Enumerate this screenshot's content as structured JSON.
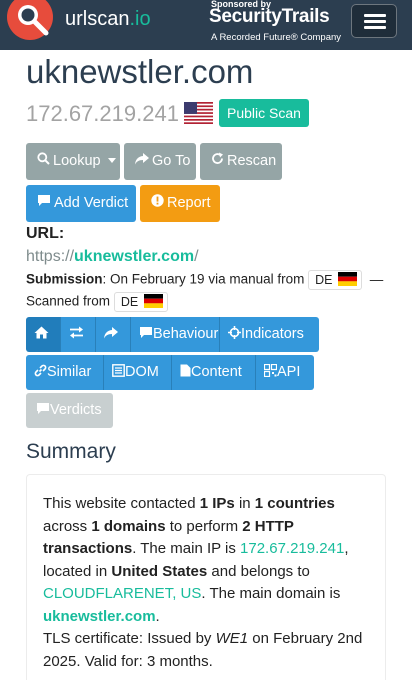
{
  "nav": {
    "brand_name": "urlscan",
    "brand_suffix": ".io",
    "sponsor_by": "Sponsored by",
    "sponsor_name": "SecurityTrails",
    "sponsor_sub": "A Recorded Future® Company"
  },
  "result": {
    "domain": "uknewstler.com",
    "ip": "172.67.219.241",
    "visibility_badge": "Public Scan"
  },
  "actions": {
    "lookup": "Lookup",
    "goto": "Go To",
    "rescan": "Rescan",
    "add_verdict": "Add Verdict",
    "report": "Report"
  },
  "url": {
    "label": "URL:",
    "scheme": "https://",
    "host": "uknewstler.com",
    "path": "/"
  },
  "submission": {
    "label": "Submission",
    "text": ": On February 19 via manual from",
    "country": "DE",
    "dash": "—",
    "scanned_label": "Scanned from",
    "scanned_country": "DE"
  },
  "tabs_row1": [
    {
      "label": ""
    },
    {
      "label": ""
    },
    {
      "label": ""
    },
    {
      "label": "Behaviour"
    },
    {
      "label": "Indicators"
    }
  ],
  "tabs_row2": [
    {
      "label": "Similar"
    },
    {
      "label": "DOM"
    },
    {
      "label": "Content"
    },
    {
      "label": "API"
    }
  ],
  "tab_verdicts": "Verdicts",
  "summary": {
    "heading": "Summary",
    "t1": "This website contacted ",
    "ips": "1 IPs",
    "t2": " in ",
    "countries": "1 countries",
    "t3": " across ",
    "domains": "1 domains",
    "t4": " to perform ",
    "http": "2 HTTP transactions",
    "t5": ". The main IP is ",
    "main_ip": "172.67.219.241",
    "t6": ", located in ",
    "location": "United States",
    "t7": " and belongs to ",
    "asn": "CLOUDFLARENET, US",
    "t8": ". The main domain is ",
    "main_domain": "uknewstler.com",
    "t9": ".",
    "tls_a": "TLS certificate: Issued by ",
    "issuer": "WE1",
    "tls_b": " on February 2nd 2025. Valid for: 3 months."
  },
  "colors": {
    "navbar": "#2c3e50",
    "accent": "#18bc9c",
    "primary": "#3498db",
    "warning": "#f39c12",
    "default": "#95a5a6"
  }
}
